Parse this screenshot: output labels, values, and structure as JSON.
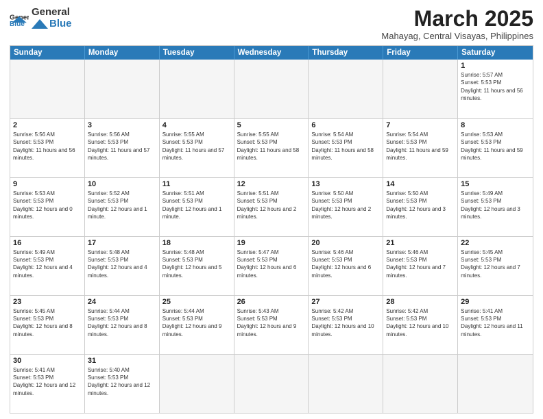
{
  "logo": {
    "general": "General",
    "blue": "Blue"
  },
  "header": {
    "month": "March 2025",
    "location": "Mahayag, Central Visayas, Philippines"
  },
  "weekdays": [
    "Sunday",
    "Monday",
    "Tuesday",
    "Wednesday",
    "Thursday",
    "Friday",
    "Saturday"
  ],
  "weeks": [
    [
      {
        "day": "",
        "empty": true
      },
      {
        "day": "",
        "empty": true
      },
      {
        "day": "",
        "empty": true
      },
      {
        "day": "",
        "empty": true
      },
      {
        "day": "",
        "empty": true
      },
      {
        "day": "",
        "empty": true
      },
      {
        "day": "1",
        "sunrise": "5:57 AM",
        "sunset": "5:53 PM",
        "daylight": "11 hours and 56 minutes."
      }
    ],
    [
      {
        "day": "2",
        "sunrise": "5:56 AM",
        "sunset": "5:53 PM",
        "daylight": "11 hours and 56 minutes."
      },
      {
        "day": "3",
        "sunrise": "5:56 AM",
        "sunset": "5:53 PM",
        "daylight": "11 hours and 57 minutes."
      },
      {
        "day": "4",
        "sunrise": "5:55 AM",
        "sunset": "5:53 PM",
        "daylight": "11 hours and 57 minutes."
      },
      {
        "day": "5",
        "sunrise": "5:55 AM",
        "sunset": "5:53 PM",
        "daylight": "11 hours and 58 minutes."
      },
      {
        "day": "6",
        "sunrise": "5:54 AM",
        "sunset": "5:53 PM",
        "daylight": "11 hours and 58 minutes."
      },
      {
        "day": "7",
        "sunrise": "5:54 AM",
        "sunset": "5:53 PM",
        "daylight": "11 hours and 59 minutes."
      },
      {
        "day": "8",
        "sunrise": "5:53 AM",
        "sunset": "5:53 PM",
        "daylight": "11 hours and 59 minutes."
      }
    ],
    [
      {
        "day": "9",
        "sunrise": "5:53 AM",
        "sunset": "5:53 PM",
        "daylight": "12 hours and 0 minutes."
      },
      {
        "day": "10",
        "sunrise": "5:52 AM",
        "sunset": "5:53 PM",
        "daylight": "12 hours and 1 minute."
      },
      {
        "day": "11",
        "sunrise": "5:51 AM",
        "sunset": "5:53 PM",
        "daylight": "12 hours and 1 minute."
      },
      {
        "day": "12",
        "sunrise": "5:51 AM",
        "sunset": "5:53 PM",
        "daylight": "12 hours and 2 minutes."
      },
      {
        "day": "13",
        "sunrise": "5:50 AM",
        "sunset": "5:53 PM",
        "daylight": "12 hours and 2 minutes."
      },
      {
        "day": "14",
        "sunrise": "5:50 AM",
        "sunset": "5:53 PM",
        "daylight": "12 hours and 3 minutes."
      },
      {
        "day": "15",
        "sunrise": "5:49 AM",
        "sunset": "5:53 PM",
        "daylight": "12 hours and 3 minutes."
      }
    ],
    [
      {
        "day": "16",
        "sunrise": "5:49 AM",
        "sunset": "5:53 PM",
        "daylight": "12 hours and 4 minutes."
      },
      {
        "day": "17",
        "sunrise": "5:48 AM",
        "sunset": "5:53 PM",
        "daylight": "12 hours and 4 minutes."
      },
      {
        "day": "18",
        "sunrise": "5:48 AM",
        "sunset": "5:53 PM",
        "daylight": "12 hours and 5 minutes."
      },
      {
        "day": "19",
        "sunrise": "5:47 AM",
        "sunset": "5:53 PM",
        "daylight": "12 hours and 6 minutes."
      },
      {
        "day": "20",
        "sunrise": "5:46 AM",
        "sunset": "5:53 PM",
        "daylight": "12 hours and 6 minutes."
      },
      {
        "day": "21",
        "sunrise": "5:46 AM",
        "sunset": "5:53 PM",
        "daylight": "12 hours and 7 minutes."
      },
      {
        "day": "22",
        "sunrise": "5:45 AM",
        "sunset": "5:53 PM",
        "daylight": "12 hours and 7 minutes."
      }
    ],
    [
      {
        "day": "23",
        "sunrise": "5:45 AM",
        "sunset": "5:53 PM",
        "daylight": "12 hours and 8 minutes."
      },
      {
        "day": "24",
        "sunrise": "5:44 AM",
        "sunset": "5:53 PM",
        "daylight": "12 hours and 8 minutes."
      },
      {
        "day": "25",
        "sunrise": "5:44 AM",
        "sunset": "5:53 PM",
        "daylight": "12 hours and 9 minutes."
      },
      {
        "day": "26",
        "sunrise": "5:43 AM",
        "sunset": "5:53 PM",
        "daylight": "12 hours and 9 minutes."
      },
      {
        "day": "27",
        "sunrise": "5:42 AM",
        "sunset": "5:53 PM",
        "daylight": "12 hours and 10 minutes."
      },
      {
        "day": "28",
        "sunrise": "5:42 AM",
        "sunset": "5:53 PM",
        "daylight": "12 hours and 10 minutes."
      },
      {
        "day": "29",
        "sunrise": "5:41 AM",
        "sunset": "5:53 PM",
        "daylight": "12 hours and 11 minutes."
      }
    ],
    [
      {
        "day": "30",
        "sunrise": "5:41 AM",
        "sunset": "5:53 PM",
        "daylight": "12 hours and 12 minutes."
      },
      {
        "day": "31",
        "sunrise": "5:40 AM",
        "sunset": "5:53 PM",
        "daylight": "12 hours and 12 minutes."
      },
      {
        "day": "",
        "empty": true
      },
      {
        "day": "",
        "empty": true
      },
      {
        "day": "",
        "empty": true
      },
      {
        "day": "",
        "empty": true
      },
      {
        "day": "",
        "empty": true
      }
    ]
  ]
}
